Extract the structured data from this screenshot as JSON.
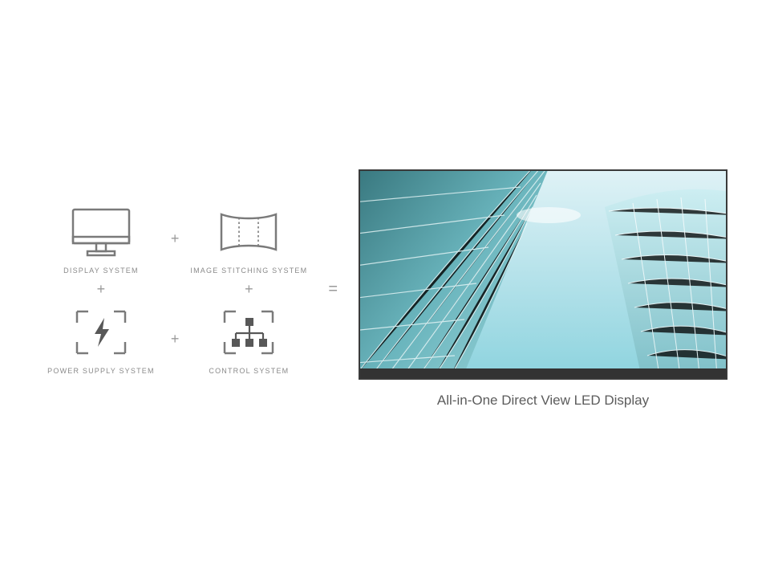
{
  "components": [
    {
      "label": "DISPLAY SYSTEM",
      "icon": "monitor-icon"
    },
    {
      "label": "IMAGE STITCHING SYSTEM",
      "icon": "stitching-icon"
    },
    {
      "label": "POWER SUPPLY SYSTEM",
      "icon": "power-icon"
    },
    {
      "label": "CONTROL SYSTEM",
      "icon": "control-icon"
    }
  ],
  "operators": {
    "plus": "+",
    "equals": "="
  },
  "result_label": "All-in-One Direct View LED Display"
}
